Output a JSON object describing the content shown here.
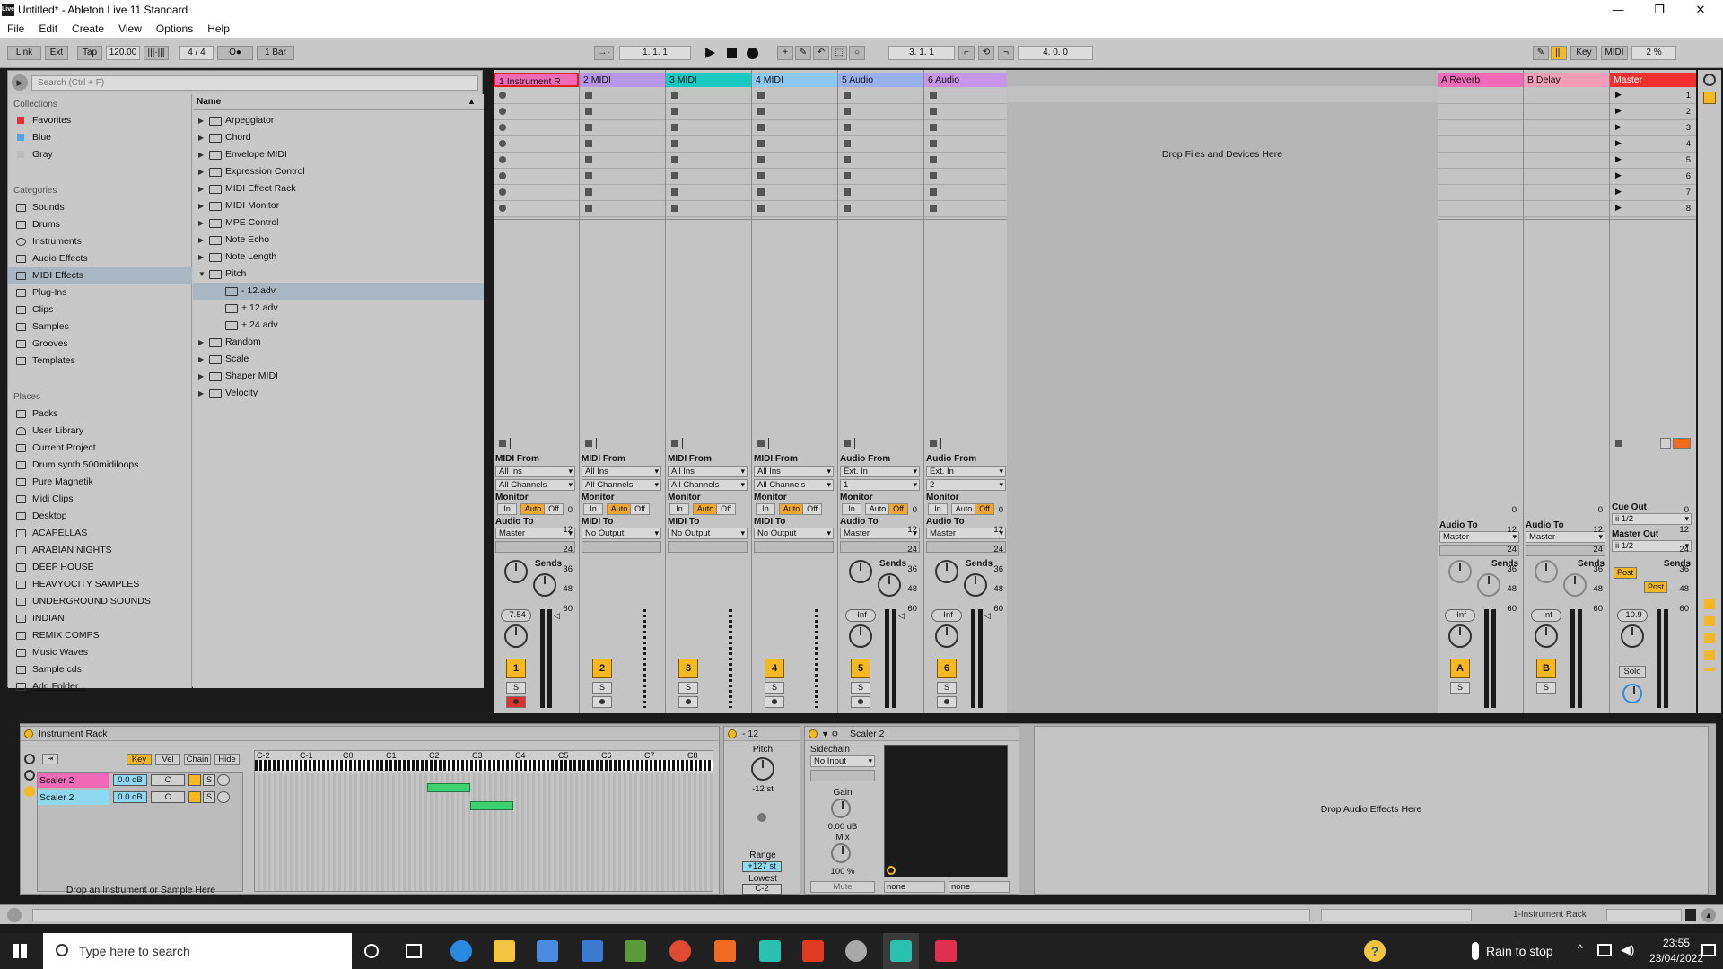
{
  "window": {
    "title": "Untitled* - Ableton Live 11 Standard",
    "logo": "Live"
  },
  "menu": [
    "File",
    "Edit",
    "Create",
    "View",
    "Options",
    "Help"
  ],
  "control_bar": {
    "link": "Link",
    "ext": "Ext",
    "tap": "Tap",
    "tempo": "120.00",
    "signature": "4 / 4",
    "metronome": "O●",
    "quantize": "1 Bar",
    "position": "1.   1.   1",
    "loop_start": "3.   1.   1",
    "loop_length": "4.   0.   0",
    "key": "Key",
    "midi": "MIDI",
    "cpu": "2 %"
  },
  "browser": {
    "search_placeholder": "Search (Ctrl + F)",
    "collections_header": "Collections",
    "collections": [
      {
        "label": "Favorites",
        "color": "#e03030"
      },
      {
        "label": "Blue",
        "color": "#4aa8e8"
      },
      {
        "label": "Gray",
        "color": "#bcbcbc"
      }
    ],
    "categories_header": "Categories",
    "categories": [
      "Sounds",
      "Drums",
      "Instruments",
      "Audio Effects",
      "MIDI Effects",
      "Plug-Ins",
      "Clips",
      "Samples",
      "Grooves",
      "Templates"
    ],
    "selected_category": "MIDI Effects",
    "places_header": "Places",
    "places": [
      "Packs",
      "User Library",
      "Current Project",
      "Drum synth 500midiloops",
      "Pure Magnetik",
      "Midi Clips",
      "Desktop",
      "ACAPELLAS",
      "ARABIAN NIGHTS",
      "DEEP HOUSE",
      "HEAVYOCITY SAMPLES",
      "UNDERGROUND SOUNDS",
      "INDIAN",
      "REMIX COMPS",
      "Music Waves",
      "Sample cds",
      "Add Folder..."
    ],
    "name_header": "Name",
    "items": [
      {
        "label": "Arpeggiator",
        "child": false,
        "sel": false
      },
      {
        "label": "Chord",
        "child": false,
        "sel": false
      },
      {
        "label": "Envelope MIDI",
        "child": false,
        "sel": false
      },
      {
        "label": "Expression Control",
        "child": false,
        "sel": false
      },
      {
        "label": "MIDI Effect Rack",
        "child": false,
        "sel": false
      },
      {
        "label": "MIDI Monitor",
        "child": false,
        "sel": false
      },
      {
        "label": "MPE Control",
        "child": false,
        "sel": false
      },
      {
        "label": "Note Echo",
        "child": false,
        "sel": false
      },
      {
        "label": "Note Length",
        "child": false,
        "sel": false
      },
      {
        "label": "Pitch",
        "child": false,
        "sel": false,
        "open": true
      },
      {
        "label": "- 12.adv",
        "child": true,
        "sel": true
      },
      {
        "label": "+ 12.adv",
        "child": true,
        "sel": false
      },
      {
        "label": "+ 24.adv",
        "child": true,
        "sel": false
      },
      {
        "label": "Random",
        "child": false,
        "sel": false
      },
      {
        "label": "Scale",
        "child": false,
        "sel": false
      },
      {
        "label": "Shaper MIDI",
        "child": false,
        "sel": false
      },
      {
        "label": "Velocity",
        "child": false,
        "sel": false
      }
    ]
  },
  "session": {
    "drop_files": "Drop Files and Devices Here",
    "tracks": [
      {
        "name": "1 Instrument R",
        "color": "#f06ab8",
        "kind": "midi",
        "from_label": "MIDI From",
        "from": "All Ins",
        "channel": "All Channels",
        "monitor_active": "Auto",
        "to_label": "Audio To",
        "to": "Master",
        "volume": "-7.54",
        "num": "1",
        "sends": true,
        "armed": true
      },
      {
        "name": "2 MIDI",
        "color": "#b896e8",
        "kind": "midi",
        "from_label": "MIDI From",
        "from": "All Ins",
        "channel": "All Channels",
        "monitor_active": "Auto",
        "to_label": "MIDI To",
        "to": "No Output",
        "volume": "",
        "num": "2",
        "sends": false,
        "armed": false
      },
      {
        "name": "3 MIDI",
        "color": "#18c9c0",
        "kind": "midi",
        "from_label": "MIDI From",
        "from": "All Ins",
        "channel": "All Channels",
        "monitor_active": "Auto",
        "to_label": "MIDI To",
        "to": "No Output",
        "volume": "",
        "num": "3",
        "sends": false,
        "armed": false
      },
      {
        "name": "4 MIDI",
        "color": "#8ec8f0",
        "kind": "midi",
        "from_label": "MIDI From",
        "from": "All Ins",
        "channel": "All Channels",
        "monitor_active": "Auto",
        "to_label": "MIDI To",
        "to": "No Output",
        "volume": "",
        "num": "4",
        "sends": false,
        "armed": false
      },
      {
        "name": "5 Audio",
        "color": "#9ab0f0",
        "kind": "audio",
        "from_label": "Audio From",
        "from": "Ext. In",
        "channel": "1",
        "monitor_active": "Off",
        "to_label": "Audio To",
        "to": "Master",
        "volume": "-Inf",
        "num": "5",
        "sends": true,
        "armed": false
      },
      {
        "name": "6 Audio",
        "color": "#c896e8",
        "kind": "audio",
        "from_label": "Audio From",
        "from": "Ext. In",
        "channel": "2",
        "monitor_active": "Off",
        "to_label": "Audio To",
        "to": "Master",
        "volume": "-Inf",
        "num": "6",
        "sends": true,
        "armed": false
      }
    ],
    "returns": [
      {
        "name": "A Reverb",
        "color": "#f06ab8",
        "to_label": "Audio To",
        "to": "Master",
        "volume": "-Inf",
        "num": "A"
      },
      {
        "name": "B Delay",
        "color": "#f29cb8",
        "to_label": "Audio To",
        "to": "Master",
        "volume": "-Inf",
        "num": "B"
      }
    ],
    "master": {
      "name": "Master",
      "color": "#f03030",
      "cue_label": "Cue Out",
      "cue": "ii 1/2",
      "out_label": "Master Out",
      "out": "ii 1/2",
      "volume": "-10.9",
      "solo": "Solo",
      "post": "Post"
    },
    "sends_label": "Sends",
    "monitor_labels": [
      "In",
      "Auto",
      "Off"
    ],
    "meter_scale": [
      "0",
      "12",
      "24",
      "36",
      "48",
      "60"
    ],
    "scenes": [
      "1",
      "2",
      "3",
      "4",
      "5",
      "6",
      "7",
      "8"
    ],
    "solo": "S"
  },
  "detail": {
    "rack": {
      "title": "Instrument Rack",
      "tabs": [
        "Key",
        "Vel",
        "Chain",
        "Hide"
      ],
      "chains": [
        {
          "name": "Scaler 2",
          "vol": "0.0 dB",
          "pan": "C",
          "color": "#f06ab8"
        },
        {
          "name": "Scaler 2",
          "vol": "0.0 dB",
          "pan": "C",
          "color": "#8ed8f0"
        }
      ],
      "drop": "Drop an Instrument or Sample Here",
      "octaves": [
        "C-2",
        "C-1",
        "C0",
        "C1",
        "C2",
        "C3",
        "C4",
        "C5",
        "C6",
        "C7",
        "C8"
      ]
    },
    "pitch": {
      "title": "- 12",
      "pitch_label": "Pitch",
      "pitch_value": "-12 st",
      "range_label": "Range",
      "range": "+127 st",
      "lowest_label": "Lowest",
      "lowest": "C-2"
    },
    "scaler": {
      "title": "Scaler 2",
      "sidechain": "Sidechain",
      "input": "No Input",
      "gain_label": "Gain",
      "gain": "0.00 dB",
      "mix_label": "Mix",
      "mix": "100 %",
      "mute": "Mute",
      "none1": "none",
      "none2": "none"
    },
    "drop_audio": "Drop Audio Effects Here"
  },
  "statusbar": {
    "track": "1-Instrument Rack"
  },
  "taskbar": {
    "search": "Type here to search",
    "weather": "Rain to stop",
    "time": "23:55",
    "date": "23/04/2022"
  }
}
